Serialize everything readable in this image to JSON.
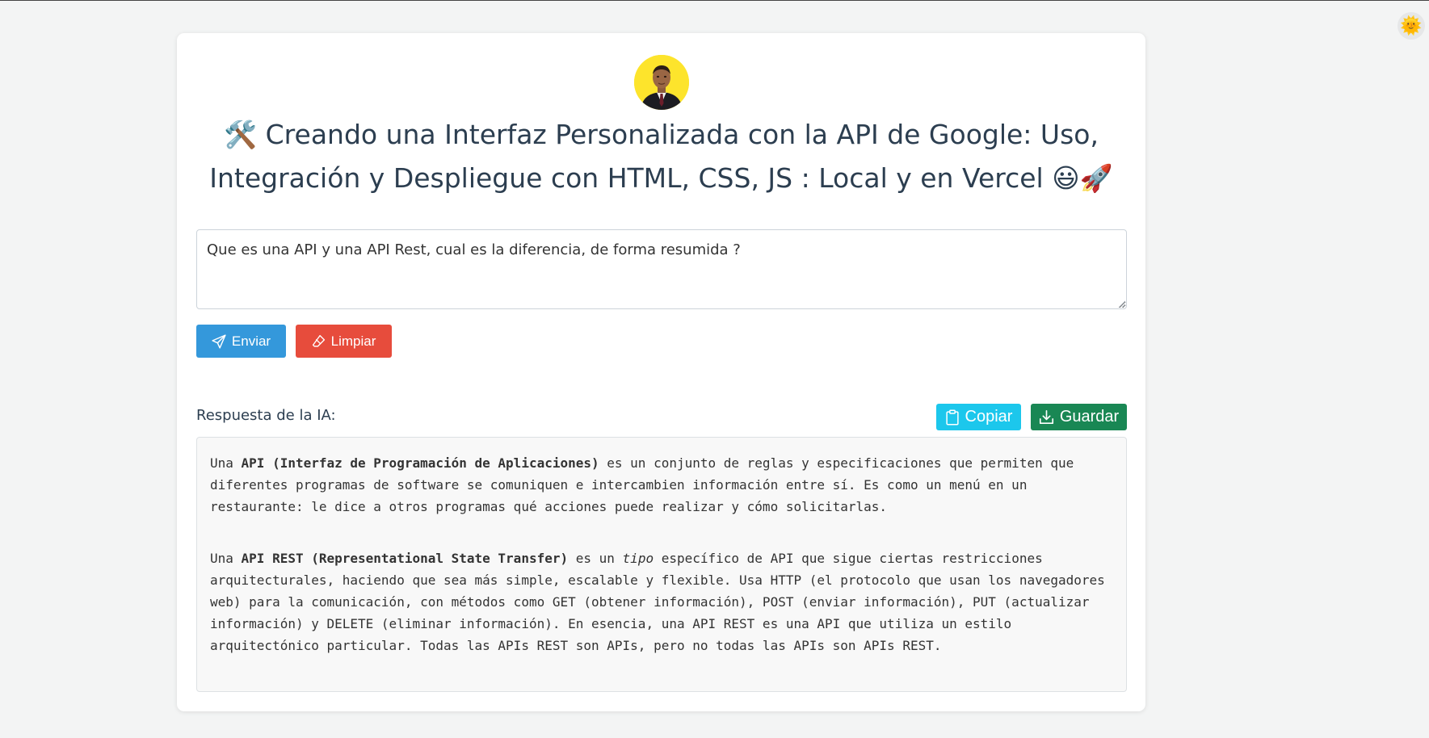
{
  "theme_toggle": {
    "icon": "sun-icon",
    "glyph": "🌞"
  },
  "header": {
    "title_line1": "🛠️ Creando una Interfaz Personalizada con la API de Google: Uso,",
    "title_line2": "Integración y Despliegue con HTML, CSS, JS : Local y en Vercel 😃🚀"
  },
  "prompt": {
    "value": "Que es una API y una API Rest, cual es la diferencia, de forma resumida ?"
  },
  "actions": {
    "send_label": "Enviar",
    "clear_label": "Limpiar"
  },
  "response_section": {
    "label": "Respuesta de la IA:",
    "copy_label": "Copiar",
    "save_label": "Guardar",
    "p1": {
      "t1": "Una ",
      "b1": "API (Interfaz de Programación de Aplicaciones)",
      "t2": " es un conjunto de reglas y especificaciones que permiten que diferentes programas de software se comuniquen e intercambien información entre sí.  Es como un menú en un restaurante: le dice a otros programas qué acciones puede realizar y cómo solicitarlas."
    },
    "p2": {
      "t1": "Una ",
      "b1": "API REST (Representational State Transfer)",
      "t2": " es un ",
      "i1": "tipo",
      "t3": " específico de API que sigue ciertas restricciones arquitecturales, haciendo que sea más simple, escalable y flexible.  Usa HTTP (el protocolo que usan los navegadores web) para la comunicación, con métodos como GET (obtener información), POST (enviar información), PUT (actualizar información) y DELETE (eliminar información).  En esencia, una API REST es una API que utiliza un estilo arquitectónico particular.  Todas las APIs REST son APIs, pero no todas las APIs son APIs REST."
    }
  }
}
